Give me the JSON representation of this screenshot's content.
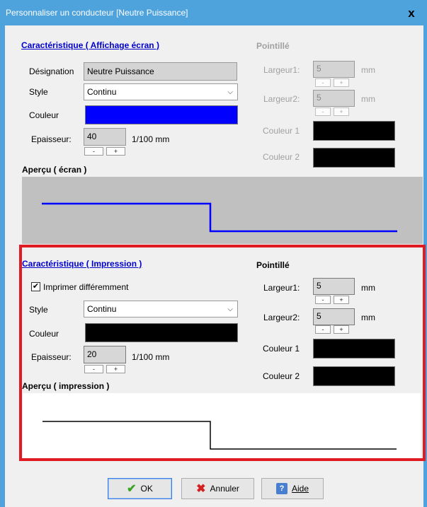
{
  "window": {
    "title": "Personnaliser un conducteur [Neutre Puissance]",
    "close_glyph": "x"
  },
  "screen": {
    "section_title": "Caractéristique ( Affichage écran )",
    "designation_label": "Désignation",
    "designation_value": "Neutre Puissance",
    "style_label": "Style",
    "style_value": "Continu",
    "color_label": "Couleur",
    "color": "#0000ff",
    "thickness_label": "Epaisseur:",
    "thickness_value": "40",
    "thickness_unit": "1/100 mm",
    "preview_title": "Aperçu ( écran )",
    "preview_bg": "#c0c0c0",
    "line_color": "#0000ff"
  },
  "screen_dotted": {
    "title": "Pointillé",
    "width1_label": "Largeur1:",
    "width1_value": "5",
    "width2_label": "Largeur2:",
    "width2_value": "5",
    "unit": "mm",
    "color1_label": "Couleur 1",
    "color2_label": "Couleur 2",
    "color1": "#000000",
    "color2": "#000000"
  },
  "print": {
    "section_title": "Caractéristique ( Impression )",
    "checkbox_label": "Imprimer différemment",
    "checkbox_checked": true,
    "style_label": "Style",
    "style_value": "Continu",
    "color_label": "Couleur",
    "color": "#000000",
    "thickness_label": "Epaisseur:",
    "thickness_value": "20",
    "thickness_unit": "1/100 mm",
    "preview_title": "Aperçu ( impression )",
    "preview_bg": "#ffffff",
    "line_color": "#000000"
  },
  "print_dotted": {
    "title": "Pointillé",
    "width1_label": "Largeur1:",
    "width1_value": "5",
    "width2_label": "Largeur2:",
    "width2_value": "5",
    "unit": "mm",
    "color1_label": "Couleur 1",
    "color2_label": "Couleur 2",
    "color1": "#000000",
    "color2": "#000000"
  },
  "stepper": {
    "minus": "-",
    "plus": "+"
  },
  "buttons": {
    "ok_label": "OK",
    "cancel_label": "Annuler",
    "help_label": "Aide",
    "ok_icon": "check-icon",
    "cancel_icon": "x-icon",
    "help_icon": "help-icon"
  },
  "highlight_color": "#e01b24"
}
